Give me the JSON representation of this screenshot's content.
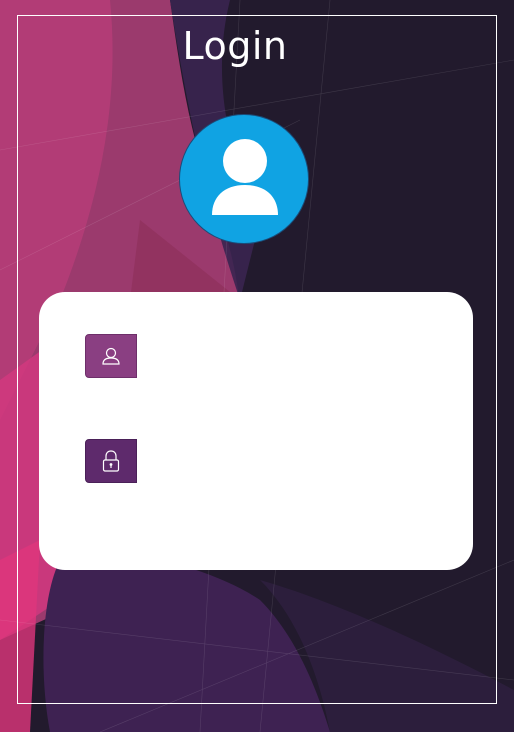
{
  "page": {
    "title": "Login"
  },
  "form": {
    "username": {
      "value": "",
      "placeholder": "",
      "icon": "user-icon"
    },
    "password": {
      "value": "",
      "placeholder": "",
      "icon": "lock-icon"
    }
  },
  "colors": {
    "avatar_bg": "#10a3e3",
    "username_icon_bg": "#8a3f82",
    "password_icon_bg": "#5e2a6c",
    "background_dark": "#231a2e",
    "background_pink": "#c8357a"
  }
}
